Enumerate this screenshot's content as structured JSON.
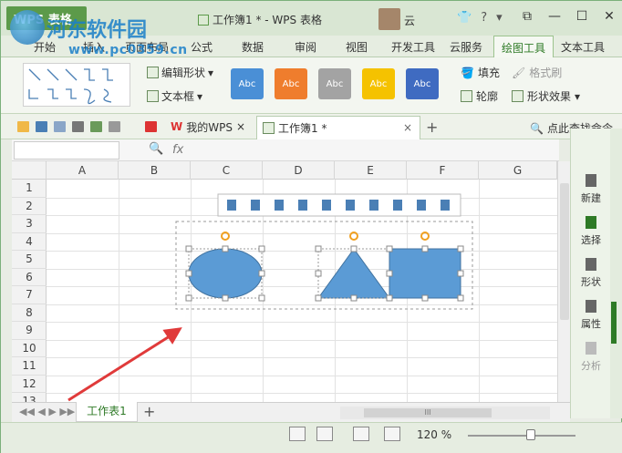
{
  "app": {
    "wps_button": "WPS 表格",
    "doc_title": "工作簿1 * - WPS 表格",
    "user": "云",
    "watermark": {
      "name": "河东软件园",
      "url": "www.pc0359.cn"
    }
  },
  "menu_tabs": [
    "开始",
    "插入",
    "页面布局",
    "公式",
    "数据",
    "审阅",
    "视图",
    "开发工具",
    "云服务",
    "绘图工具",
    "文本工具"
  ],
  "active_tab": "绘图工具",
  "ribbon": {
    "edit_shape": "编辑形状",
    "text_box": "文本框",
    "style_label": "Abc",
    "styles": [
      "#4a8fd6",
      "#ef7d2d",
      "#a3a3a3",
      "#f5c200",
      "#3f6bc1"
    ],
    "fill": "填充",
    "outline": "轮廓",
    "format_painter": "格式刷",
    "shape_effects": "形状效果"
  },
  "quickbar": {
    "my_wps": "我的WPS",
    "doc_tab": "工作簿1 *",
    "search_cmd": "点此查找命令"
  },
  "formula_bar": {
    "fx": "fx"
  },
  "columns": [
    "A",
    "B",
    "C",
    "D",
    "E",
    "F",
    "G"
  ],
  "rows": [
    "1",
    "2",
    "3",
    "4",
    "5",
    "6",
    "7",
    "8",
    "9",
    "10",
    "11",
    "12",
    "13"
  ],
  "task_pane": [
    "新建",
    "选择",
    "形状",
    "属性",
    "分析"
  ],
  "sheet": {
    "tab": "工作表1",
    "scroll_label": "III"
  },
  "status": {
    "zoom": "120 %"
  },
  "colors": {
    "shape_fill": "#5b9bd5",
    "shape_stroke": "#41729f",
    "arrow": "#e03a3a",
    "accent": "#2e7a26"
  }
}
